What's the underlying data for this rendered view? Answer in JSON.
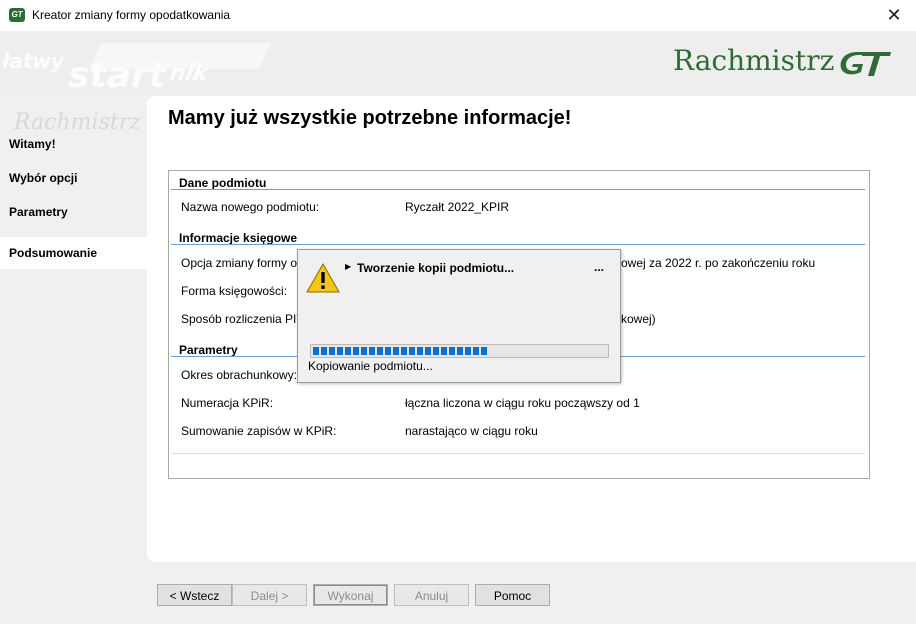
{
  "window": {
    "title": "Kreator zmiany formy opodatkowania",
    "close_glyph": "✕",
    "icon_text": "GT"
  },
  "banner": {
    "logo_text": "Rachmistrz",
    "watermark_1": "łatwy",
    "watermark_2": "start",
    "watermark_3": "nik",
    "nav_watermark": "Rachmistrz"
  },
  "nav": {
    "items": [
      {
        "label": "Witamy!",
        "active": false
      },
      {
        "label": "Wybór opcji",
        "active": false
      },
      {
        "label": "Parametry",
        "active": false
      },
      {
        "label": "Podsumowanie",
        "active": true
      }
    ]
  },
  "main": {
    "heading": "Mamy już wszystkie potrzebne informacje!",
    "sections": {
      "dane": {
        "title": "Dane podmiotu",
        "rows": [
          {
            "label": "Nazwa nowego podmiotu:",
            "value": "Ryczałt 2022_KPIR"
          }
        ]
      },
      "ksiegowe": {
        "title": "Informacje księgowe",
        "rows": [
          {
            "label": "Opcja zmiany formy op",
            "value": "owej za 2022 r. po zakończeniu roku"
          },
          {
            "label": "Forma księgowości:",
            "value": ""
          },
          {
            "label": "Sposób rozliczenia PIT",
            "value": "kowej)"
          }
        ]
      },
      "parametry": {
        "title": "Parametry",
        "rows": [
          {
            "label": "Okres obrachunkowy:",
            "value": ""
          },
          {
            "label": "Numeracja KPiR:",
            "value": "łączna liczona w ciągu roku począwszy od 1"
          },
          {
            "label": "Sumowanie zapisów w KPiR:",
            "value": "narastająco w ciągu roku"
          }
        ]
      }
    }
  },
  "dialog": {
    "title": "Tworzenie kopii podmiotu...",
    "more": "...",
    "status": "Kopiowanie podmiotu...",
    "progress_fraction": 0.6,
    "icon": "warning-icon"
  },
  "buttons": {
    "back": "< Wstecz",
    "next": "Dalej >",
    "execute": "Wykonaj",
    "cancel": "Anuluj",
    "help": "Pomoc"
  },
  "colors": {
    "brand_green": "#2f6b34",
    "progress_blue": "#0a6fd1",
    "section_line": "#6f9fd8"
  }
}
